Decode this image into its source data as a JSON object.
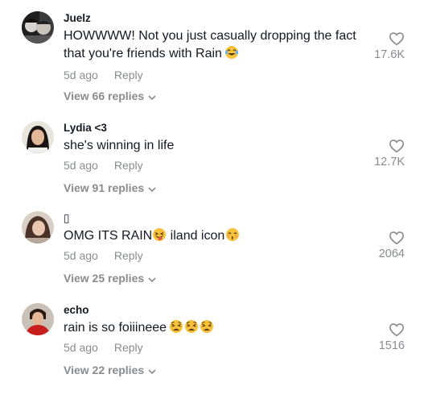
{
  "comments": [
    {
      "username": "Juelz",
      "text": "HOWWWW! Not you just casually dropping the fact that you're friends with Rain",
      "emojis": [
        "tears-of-joy-emoji"
      ],
      "time": "5d ago",
      "reply_label": "Reply",
      "view_replies": "View 66 replies",
      "likes": "17.6K"
    },
    {
      "username": "Lydia <3",
      "text": "she's winning in life",
      "time": "5d ago",
      "reply_label": "Reply",
      "view_replies": "View 91 replies",
      "likes": "12.7K"
    },
    {
      "username": "▯",
      "text_part1": "OMG ITS RAIN",
      "text_part2": " iland icon",
      "emojis": [
        "tongue-out-emoji",
        "kissing-smile-emoji"
      ],
      "time": "5d ago",
      "reply_label": "Reply",
      "view_replies": "View 25 replies",
      "likes": "2064"
    },
    {
      "username": "echo",
      "text": "rain is so foiiineee",
      "emojis": [
        "weary-face-emoji",
        "weary-face-emoji",
        "weary-face-emoji"
      ],
      "time": "5d ago",
      "reply_label": "Reply",
      "view_replies": "View 22 replies",
      "likes": "1516"
    }
  ],
  "colors": {
    "text": "#161823",
    "muted": "#8a8b91",
    "emoji_yellow": "#f7c23a"
  }
}
